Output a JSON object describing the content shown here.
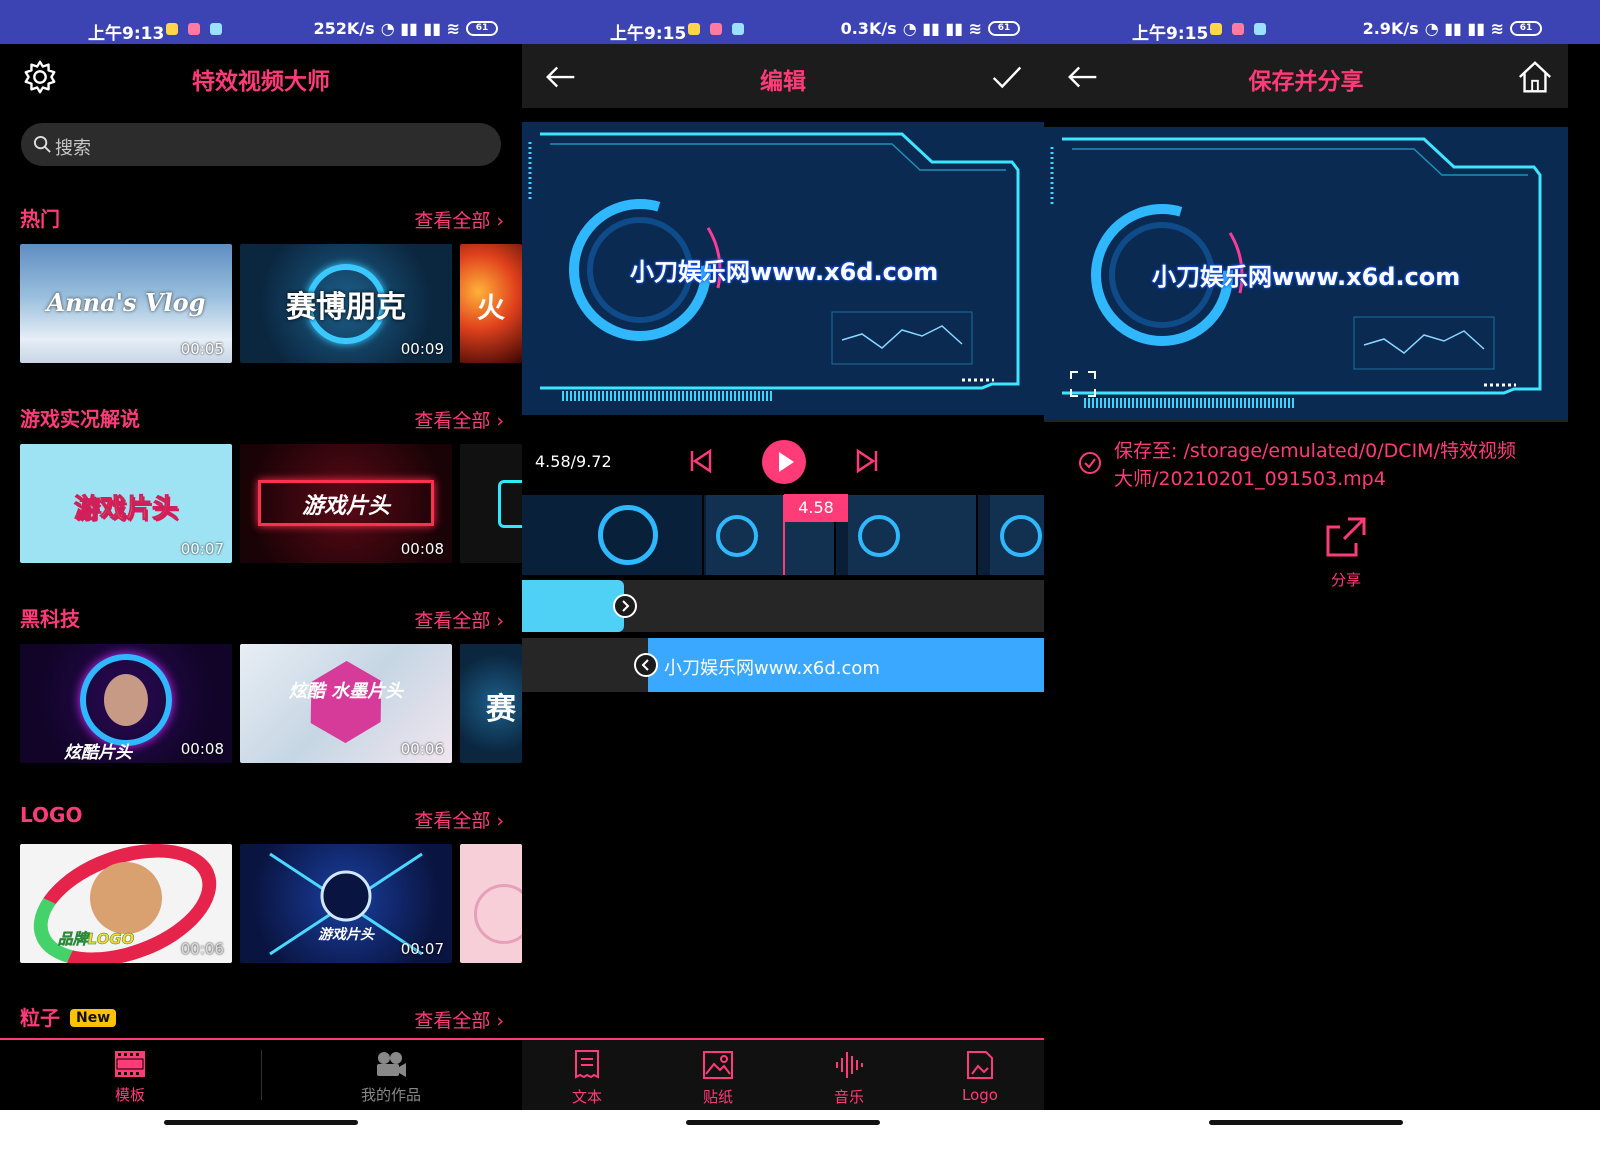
{
  "colors": {
    "accent": "#ff3b78",
    "statusbar": "#3c44b4",
    "background": "#000000"
  },
  "statusbars": [
    {
      "time": "上午9:13",
      "net": "252K/s",
      "battery": "61"
    },
    {
      "time": "上午9:15",
      "net": "0.3K/s",
      "battery": "61"
    },
    {
      "time": "上午9:15",
      "net": "2.9K/s",
      "battery": "61"
    }
  ],
  "home": {
    "title": "特效视频大师",
    "settings_icon": "gear-icon",
    "search_placeholder": "搜索",
    "see_all": "查看全部 ›",
    "sections": [
      {
        "title": "热门",
        "thumbs": [
          {
            "text": "Anna's Vlog",
            "duration": "00:05"
          },
          {
            "text": "赛博朋克",
            "duration": "00:09"
          },
          {
            "text": "火"
          }
        ]
      },
      {
        "title": "游戏实况解说",
        "thumbs": [
          {
            "text": "游戏片头",
            "duration": "00:07"
          },
          {
            "text": "游戏片头",
            "duration": "00:08"
          },
          {
            "text": ""
          }
        ]
      },
      {
        "title": "黑科技",
        "thumbs": [
          {
            "text": "炫酷片头",
            "duration": "00:08"
          },
          {
            "text": "炫酷 水墨片头",
            "duration": "00:06"
          },
          {
            "text": "赛"
          }
        ]
      },
      {
        "title": "LOGO",
        "thumbs": [
          {
            "text": "品牌LOGO",
            "duration": "00:06"
          },
          {
            "text": "游戏片头",
            "duration": "00:07"
          },
          {
            "text": ""
          }
        ]
      },
      {
        "title": "粒子",
        "badge": "New"
      }
    ],
    "tabs": [
      {
        "label": "模板",
        "icon": "film-strip-icon"
      },
      {
        "label": "我的作品",
        "icon": "camera-icon"
      }
    ]
  },
  "editor": {
    "title": "编辑",
    "back_icon": "arrow-left-icon",
    "confirm_icon": "checkmark-icon",
    "watermark": "小刀娱乐网www.x6d.com",
    "time_readout": "4.58/9.72",
    "playhead_value": "4.58",
    "text_clip": "小刀娱乐网www.x6d.com",
    "tools": [
      {
        "label": "文本",
        "icon": "text-document-icon"
      },
      {
        "label": "贴纸",
        "icon": "sticker-image-icon"
      },
      {
        "label": "音乐",
        "icon": "music-wave-icon"
      },
      {
        "label": "Logo",
        "icon": "logo-image-icon"
      }
    ]
  },
  "save": {
    "title": "保存并分享",
    "back_icon": "arrow-left-icon",
    "home_icon": "home-icon",
    "watermark": "小刀娱乐网www.x6d.com",
    "saved_to": "保存至: /storage/emulated/0/DCIM/特效视频大师/20210201_091503.mp4",
    "share_label": "分享"
  }
}
